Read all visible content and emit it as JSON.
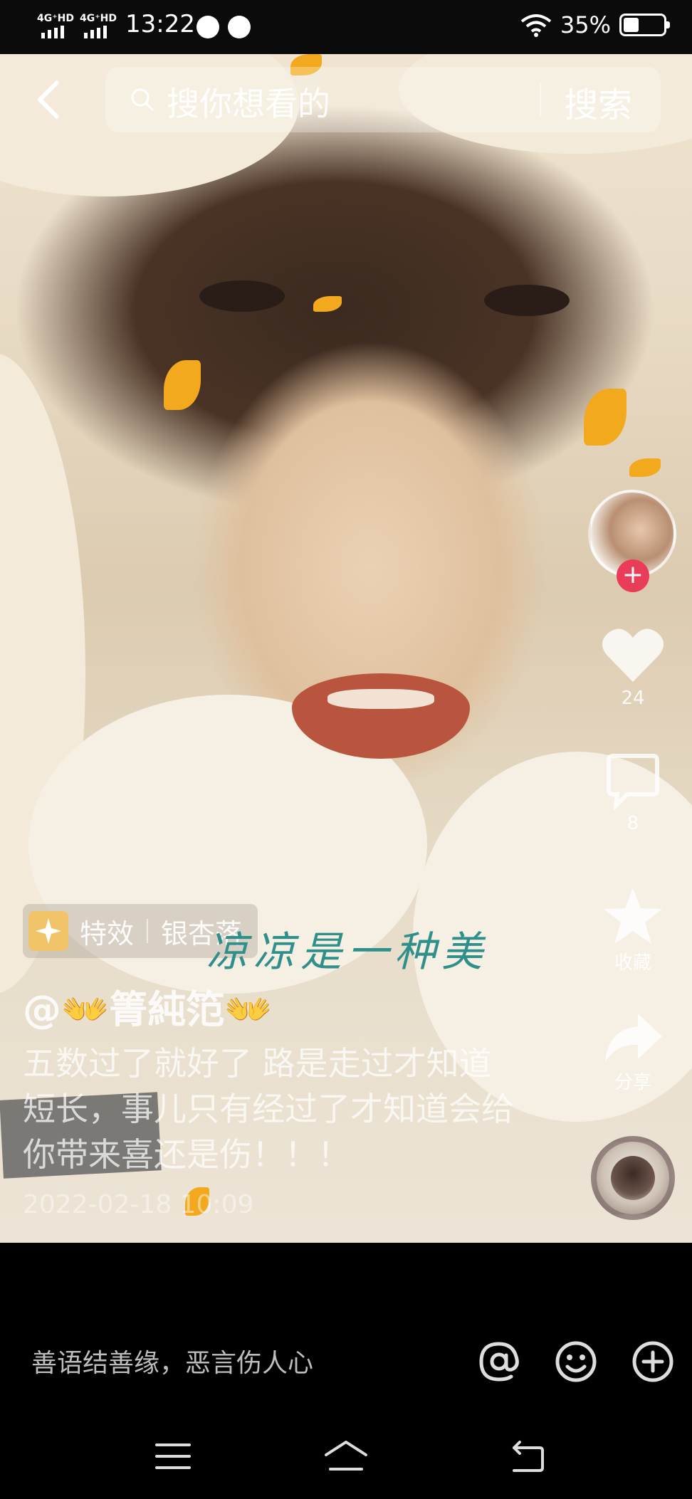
{
  "status_bar": {
    "network1": "4G⁺HD",
    "network2": "4G⁺HD",
    "time": "13:22",
    "battery": "35%",
    "battery_level": 0.35
  },
  "search": {
    "placeholder": "搜你想看的",
    "button_label": "搜索"
  },
  "actions": {
    "likes": "24",
    "comments": "8",
    "favorite_label": "收藏",
    "share_label": "分享"
  },
  "effect": {
    "label": "特效",
    "name": "银杏落"
  },
  "video": {
    "overlay_caption": "凉凉是一种美",
    "author": "@👐箐純笵👐",
    "description": "五数过了就好了 路是走过才知道短长，事儿只有经过了才知道会给你带来喜还是伤！！！",
    "date": "2022-02-18 10:09"
  },
  "comment_bar": {
    "placeholder": "善语结善缘，恶言伤人心"
  },
  "icons": {
    "back": "back-arrow-icon",
    "search": "search-icon",
    "like": "heart-icon",
    "comment": "comment-icon",
    "favorite": "star-icon",
    "share": "share-arrow-icon",
    "mention": "at-icon",
    "emoji": "emoji-icon",
    "add": "plus-circle-icon"
  },
  "colors": {
    "follow_badge": "#e83c58",
    "caption": "#2f8f8a",
    "leaf": "#f2a91d"
  }
}
